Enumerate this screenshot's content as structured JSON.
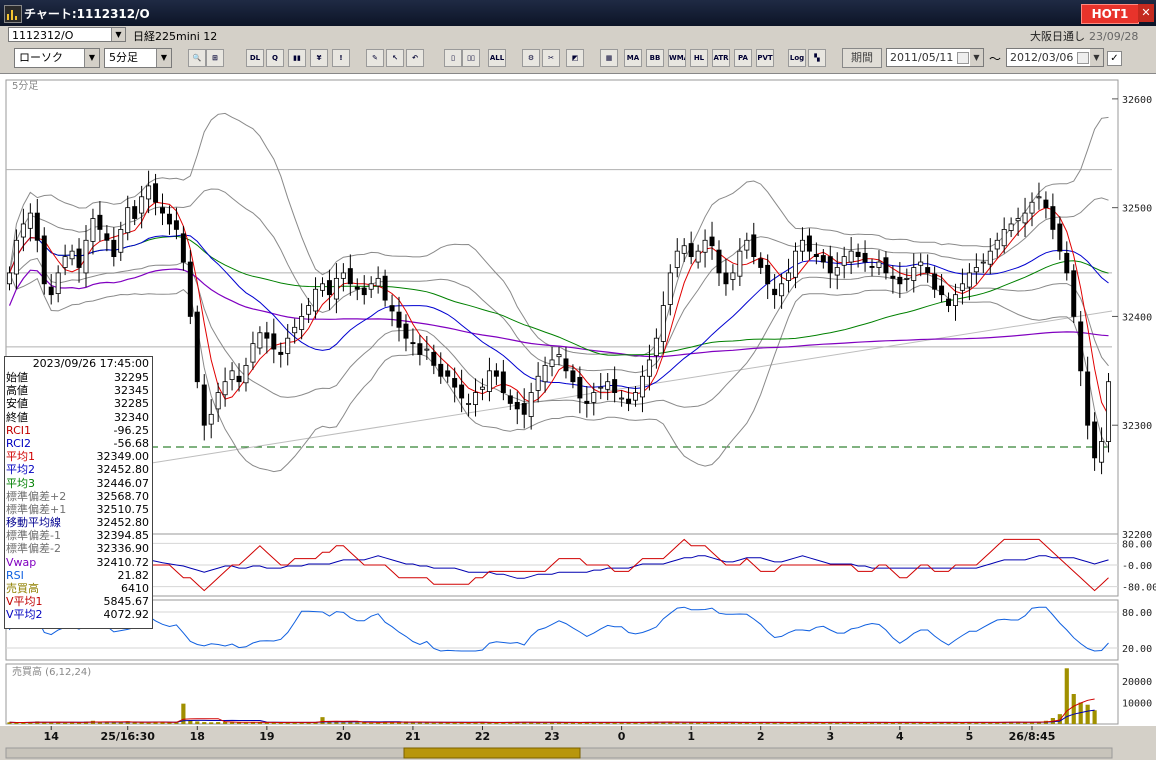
{
  "window": {
    "title": "チャート:1112312/O"
  },
  "hot_badge": "HOT1",
  "close_glyph": "✕",
  "symbol_code": "1112312/O",
  "instrument": "日経225mini 12",
  "exchange": "大阪日通し",
  "exchange_date": "23/09/28",
  "chart_type_select": "ローソク",
  "interval_select": "5分足",
  "period_button": "期間",
  "date_from": "2011/05/11",
  "date_separator": "～",
  "date_to": "2012/03/06",
  "toolbar_buttons": [
    {
      "icon": "zoom-icon",
      "label": "🔍"
    },
    {
      "icon": "split-icon",
      "label": "⊞"
    },
    {
      "icon": "download-icon",
      "label": "DL"
    },
    {
      "icon": "search-chart-icon",
      "label": "Q"
    },
    {
      "icon": "bar-chart-icon",
      "label": "▮▮"
    },
    {
      "icon": "price-icon",
      "label": "¥"
    },
    {
      "icon": "warning-icon",
      "label": "!"
    },
    {
      "icon": "pen-icon",
      "label": "✎"
    },
    {
      "icon": "cursor-icon",
      "label": "↖"
    },
    {
      "icon": "undo-icon",
      "label": "↶"
    },
    {
      "icon": "candle-icon",
      "label": "▯"
    },
    {
      "icon": "candle2-icon",
      "label": "▯▯"
    },
    {
      "icon": "all-icon",
      "label": "ALL"
    },
    {
      "icon": "settings-icon",
      "label": "⚙"
    },
    {
      "icon": "tool-icon",
      "label": "✂"
    },
    {
      "icon": "color-icon",
      "label": "◩"
    },
    {
      "icon": "grid-icon",
      "label": "▦"
    },
    {
      "icon": "ma-icon",
      "label": "MA"
    },
    {
      "icon": "bb-icon",
      "label": "BB"
    },
    {
      "icon": "wma-icon",
      "label": "WMA"
    },
    {
      "icon": "hl-icon",
      "label": "HL"
    },
    {
      "icon": "atr-icon",
      "label": "ATR"
    },
    {
      "icon": "pa-icon",
      "label": "PA"
    },
    {
      "icon": "pvt-icon",
      "label": "PVT"
    },
    {
      "icon": "log-icon",
      "label": "Log"
    },
    {
      "icon": "layout-icon",
      "label": "▚"
    }
  ],
  "colors": {
    "background": "#000000",
    "candle_up": "#ffffff",
    "candle_down": "#000000",
    "avg1": "#e00000",
    "avg2": "#0000d0",
    "avg3": "#008000",
    "vwap": "#8000c0",
    "bollinger": "#8a8a8a",
    "rci1": "#d00000",
    "rci2": "#0000b0",
    "rsi": "#1060e0",
    "volume": "#a09000",
    "dashed_level": "#006400"
  },
  "info_panel": {
    "datetime": "2023/09/26  17:45:00",
    "rows": [
      {
        "label": "始値",
        "value": "32295",
        "color": "#000000"
      },
      {
        "label": "高値",
        "value": "32345",
        "color": "#000000"
      },
      {
        "label": "安値",
        "value": "32285",
        "color": "#000000"
      },
      {
        "label": "終値",
        "value": "32340",
        "color": "#000000"
      },
      {
        "label": "RCI1",
        "value": "-96.25",
        "color": "#c00000"
      },
      {
        "label": "RCI2",
        "value": "-56.68",
        "color": "#0000c0"
      },
      {
        "label": "平均1",
        "value": "32349.00",
        "color": "#d00000"
      },
      {
        "label": "平均2",
        "value": "32452.80",
        "color": "#0000c0"
      },
      {
        "label": "平均3",
        "value": "32446.07",
        "color": "#008000"
      },
      {
        "label": "標準偏差+2",
        "value": "32568.70",
        "color": "#707070"
      },
      {
        "label": "標準偏差+1",
        "value": "32510.75",
        "color": "#707070"
      },
      {
        "label": "移動平均線",
        "value": "32452.80",
        "color": "#000090"
      },
      {
        "label": "標準偏差-1",
        "value": "32394.85",
        "color": "#707070"
      },
      {
        "label": "標準偏差-2",
        "value": "32336.90",
        "color": "#707070"
      },
      {
        "label": "Vwap",
        "value": "32410.72",
        "color": "#8000c0"
      },
      {
        "label": "RSI",
        "value": "21.82",
        "color": "#1060e0"
      },
      {
        "label": "売買高",
        "value": "6410",
        "color": "#908000"
      },
      {
        "label": "V平均1",
        "value": "5845.67",
        "color": "#c00000"
      },
      {
        "label": "V平均2",
        "value": "4072.92",
        "color": "#0000c0"
      }
    ]
  },
  "chart_data": [
    {
      "type": "candlestick",
      "panel": "price",
      "corner_label": "5分足",
      "y_ticks": [
        "32600",
        "32500",
        "32400",
        "32300",
        "32200"
      ],
      "ylim": [
        32200,
        32610
      ],
      "x_ticks": [
        "14",
        "25/16:30",
        "18",
        "19",
        "20",
        "21",
        "22",
        "23",
        "0",
        "1",
        "2",
        "3",
        "4",
        "5",
        "26/8:45"
      ],
      "dashed_level": 32280,
      "closes": [
        32440,
        32470,
        32485,
        32495,
        32470,
        32430,
        32420,
        32440,
        32455,
        32460,
        32445,
        32470,
        32490,
        32480,
        32470,
        32455,
        32480,
        32500,
        32490,
        32510,
        32520,
        32505,
        32495,
        32485,
        32480,
        32450,
        32400,
        32340,
        32300,
        32310,
        32330,
        32340,
        32350,
        32340,
        32355,
        32375,
        32385,
        32380,
        32370,
        32365,
        32380,
        32390,
        32400,
        32410,
        32425,
        32430,
        32420,
        32435,
        32440,
        32430,
        32425,
        32420,
        32430,
        32435,
        32415,
        32405,
        32390,
        32380,
        32375,
        32365,
        32370,
        32355,
        32345,
        32345,
        32335,
        32325,
        32320,
        32330,
        32335,
        32350,
        32345,
        32330,
        32320,
        32315,
        32310,
        32330,
        32345,
        32355,
        32360,
        32365,
        32350,
        32340,
        32325,
        32320,
        32330,
        32335,
        32340,
        32330,
        32325,
        32320,
        32330,
        32345,
        32360,
        32380,
        32410,
        32440,
        32460,
        32465,
        32455,
        32460,
        32470,
        32465,
        32440,
        32430,
        32440,
        32460,
        32470,
        32455,
        32445,
        32430,
        32420,
        32430,
        32440,
        32460,
        32470,
        32460,
        32455,
        32450,
        32440,
        32445,
        32455,
        32460,
        32455,
        32450,
        32445,
        32450,
        32440,
        32435,
        32430,
        32435,
        32445,
        32450,
        32440,
        32425,
        32420,
        32410,
        32420,
        32430,
        32440,
        32445,
        32450,
        32460,
        32470,
        32480,
        32485,
        32490,
        32495,
        32505,
        32510,
        32500,
        32480,
        32460,
        32440,
        32400,
        32350,
        32300,
        32270,
        32285,
        32340
      ]
    },
    {
      "type": "line",
      "panel": "rci",
      "series": [
        {
          "name": "RCI1"
        },
        {
          "name": "RCI2"
        }
      ],
      "y_ticks": [
        "80.00",
        "-0.00",
        "-80.00"
      ],
      "ylim": [
        -100,
        100
      ]
    },
    {
      "type": "line",
      "panel": "rsi",
      "series": [
        {
          "name": "RSI"
        }
      ],
      "y_ticks": [
        "80.00",
        "20.00"
      ],
      "ylim": [
        0,
        100
      ]
    },
    {
      "type": "bar",
      "panel": "volume",
      "title": "売買高 (6,12,24)",
      "y_ticks": [
        "20000",
        "10000"
      ],
      "ylim": [
        0,
        28000
      ],
      "values": [
        800,
        600,
        700,
        900,
        1200,
        900,
        700,
        800,
        600,
        700,
        900,
        1100,
        1500,
        900,
        700,
        800,
        900,
        1300,
        800,
        700,
        600,
        900,
        1000,
        700,
        800,
        9500,
        1500,
        1200,
        900,
        800,
        900,
        1000,
        700,
        800,
        600,
        700,
        900,
        800,
        700,
        600,
        700,
        800,
        900,
        700,
        800,
        3200,
        900,
        1000,
        800,
        900,
        700,
        800,
        600,
        700,
        1000,
        900,
        800,
        1200,
        900,
        800,
        700,
        600,
        700,
        900,
        800,
        700,
        600,
        800,
        900,
        700,
        600,
        700,
        800,
        1000,
        900,
        800,
        700,
        600,
        700,
        900,
        800,
        700,
        600,
        700,
        800,
        900,
        700,
        800,
        600,
        700,
        900,
        800,
        1000,
        1100,
        900,
        800,
        700,
        600,
        700,
        800,
        900,
        700,
        600,
        700,
        800,
        900,
        700,
        600,
        700,
        800,
        900,
        700,
        600,
        700,
        800,
        900,
        700,
        600,
        700,
        800,
        900,
        700,
        600,
        700,
        800,
        900,
        700,
        600,
        700,
        800,
        900,
        700,
        600,
        700,
        800,
        900,
        700,
        600,
        700,
        800,
        900,
        700,
        800,
        900,
        1000,
        900,
        800,
        700,
        900,
        1500,
        2800,
        4600,
        26000,
        14000,
        10000,
        9000,
        6410
      ]
    }
  ]
}
